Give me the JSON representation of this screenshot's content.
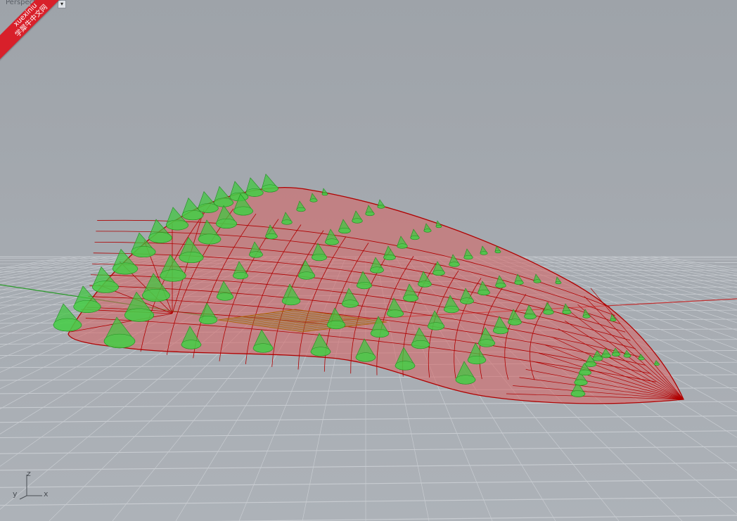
{
  "viewport": {
    "title": "Perspective",
    "menu_glyph": "▾",
    "background_top": "#9ea3a9",
    "background_bottom": "#a9aeb4"
  },
  "watermark": {
    "line1": "xuexiniu",
    "line2": "学犀牛中文网",
    "color": "#d8202a"
  },
  "axis_widget": {
    "z": "z",
    "y": "y",
    "x": "x"
  },
  "colors": {
    "surface_fill": "#d96060",
    "surface_line": "#b00000",
    "cone_fill": "#3fc83f",
    "grid_line": "#c8ccd1",
    "x_axis": "#c03030",
    "y_axis": "#2a9a2a"
  }
}
